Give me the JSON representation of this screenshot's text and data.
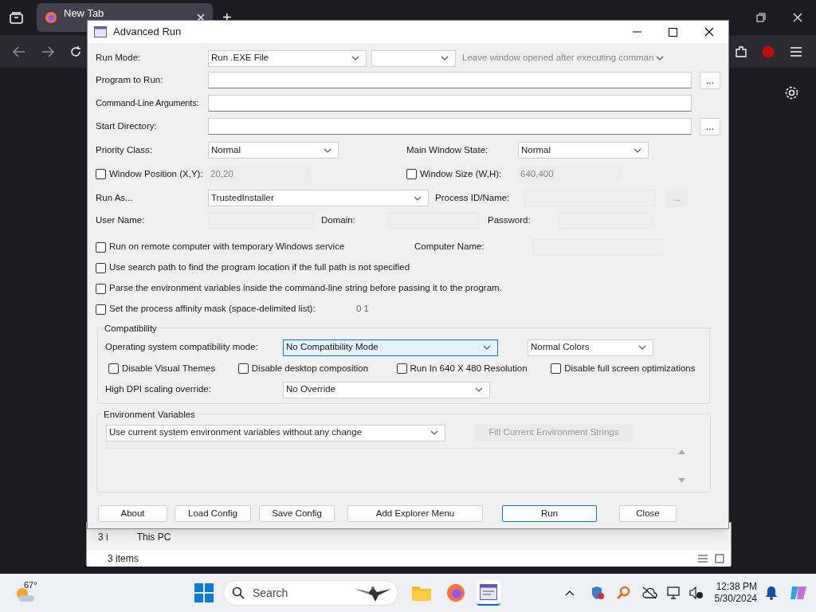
{
  "browser": {
    "tab": {
      "title": "New Tab",
      "selected": true
    },
    "new_tab": "+"
  },
  "dialog": {
    "title": "Advanced Run",
    "run_mode": {
      "label": "Run Mode:",
      "value": "Run .EXE File",
      "leave_window": "Leave window opened after executing comman"
    },
    "paths": [
      {
        "label": "Program to Run:",
        "browse": "..."
      },
      {
        "label": "Command-Line Arguments:"
      },
      {
        "label": "Start Directory:",
        "browse": "..."
      }
    ],
    "priority": {
      "label": "Priority Class:",
      "value": "Normal"
    },
    "main_window_state": {
      "label": "Main Window State:",
      "value": "Normal"
    },
    "window_position": {
      "label": "Window Position (X,Y):",
      "checked": false,
      "value": "20,20"
    },
    "window_size": {
      "label": "Window Size (W,H):",
      "checked": false,
      "value": "640,400"
    },
    "run_as": {
      "label": "Run As...",
      "value": "TrustedInstaller"
    },
    "process": {
      "label": "Process ID/Name:",
      "browse": "..."
    },
    "credentials": [
      {
        "label": "User Name:"
      },
      {
        "label": "Domain:"
      },
      {
        "label": "Password:"
      }
    ],
    "options": [
      {
        "label": "Run on remote computer with temporary Windows service",
        "checked": false,
        "extra_label": "Computer Name:"
      },
      {
        "label": "Use search path to find the program location if the full path is not specified",
        "checked": false
      },
      {
        "label": "Parse the environment variables inside the command-line string before passing it to the program.",
        "checked": false
      },
      {
        "label": "Set the process affinity mask (space-delimited list):",
        "checked": false,
        "value": "0 1"
      }
    ],
    "compatibility": {
      "title": "Compatibility",
      "os_mode": {
        "label": "Operating system compatibility mode:",
        "value": "No Compatibility Mode",
        "focused": true
      },
      "colors": "Normal Colors",
      "checkboxes": [
        {
          "label": "Disable Visual Themes",
          "checked": false
        },
        {
          "label": "Disable desktop composition",
          "checked": false
        },
        {
          "label": "Run In 640 X 480 Resolution",
          "checked": false
        },
        {
          "label": "Disable full screen optimizations",
          "checked": false
        }
      ],
      "dpi": {
        "label": "High DPI scaling override:",
        "value": "No Override"
      }
    },
    "environment": {
      "title": "Environment Variables",
      "mode": "Use current system environment variables without any change",
      "fill_button": "Fill Current Environment Strings"
    },
    "buttons": [
      {
        "label": "About",
        "default": false
      },
      {
        "label": "Load Config",
        "default": false
      },
      {
        "label": "Save Config",
        "default": false
      },
      {
        "label": "Add Explorer Menu",
        "default": false
      },
      {
        "label": "Run",
        "default": true
      },
      {
        "label": "Close",
        "default": false
      }
    ]
  },
  "explorer": {
    "cut_text": "3 i",
    "tree_item": "This PC",
    "status": "3 items"
  },
  "taskbar": {
    "temperature": "67°",
    "search": "Search",
    "time": "12:38 PM",
    "date": "5/30/2024"
  }
}
